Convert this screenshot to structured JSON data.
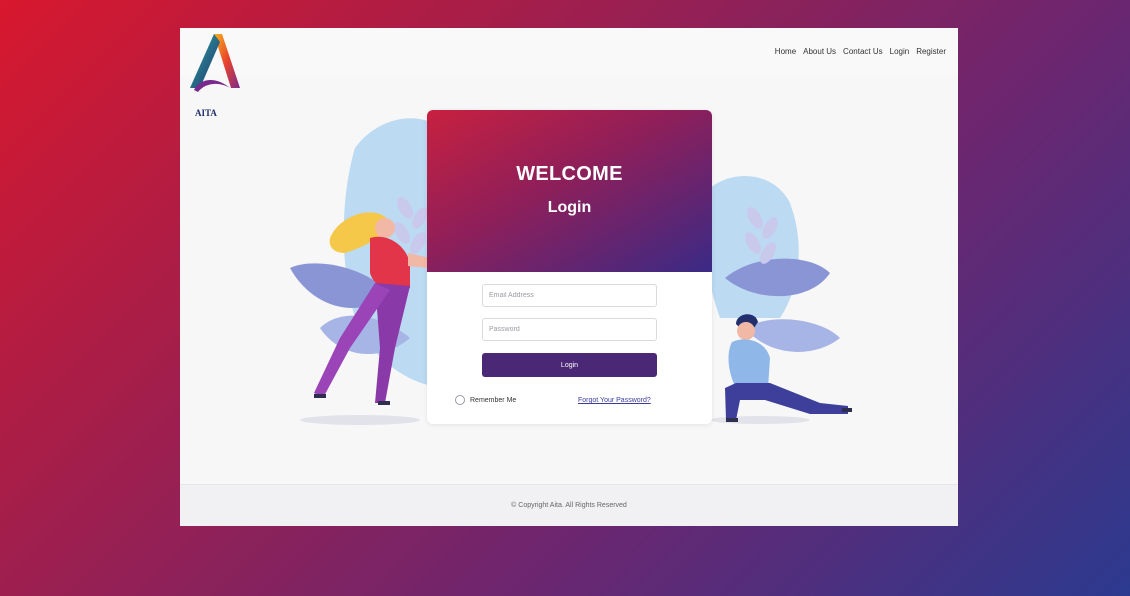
{
  "brand": {
    "name": "AITA",
    "colors": {
      "accent": "#4b2875",
      "header_start": "#c8203f",
      "header_end": "#3a2a85"
    }
  },
  "nav": {
    "items": [
      "Home",
      "About Us",
      "Contact Us",
      "Login",
      "Register"
    ]
  },
  "card": {
    "welcome": "WELCOME",
    "title": "Login",
    "email_placeholder": "Email Address",
    "password_placeholder": "Password",
    "login_button": "Login",
    "remember_label": "Remember Me",
    "forgot_link": "Forgot Your Password?"
  },
  "footer": {
    "copyright": "© Copyright Aita. All Rights Reserved"
  },
  "icons": [
    "logo-a-icon",
    "remember-radio-icon"
  ]
}
